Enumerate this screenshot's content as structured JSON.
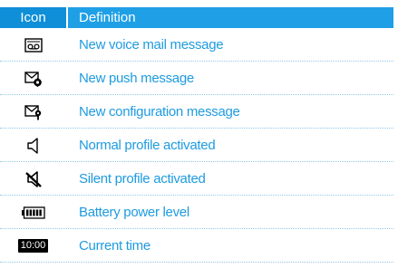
{
  "header": {
    "icon_col": "Icon",
    "definition_col": "Definition"
  },
  "rows": [
    {
      "icon": "voicemail-icon",
      "definition": "New voice mail message"
    },
    {
      "icon": "push-message-icon",
      "definition": "New push message"
    },
    {
      "icon": "configuration-message-icon",
      "definition": "New configuration message"
    },
    {
      "icon": "speaker-icon",
      "definition": "Normal profile activated"
    },
    {
      "icon": "speaker-muted-icon",
      "definition": "Silent profile activated"
    },
    {
      "icon": "battery-icon",
      "definition": "Battery power level"
    },
    {
      "icon": "clock-icon",
      "definition": "Current time",
      "icon_text": "10:00"
    }
  ],
  "colors": {
    "header_icon_bg": "#0f8fd8",
    "header_def_bg": "#1fa0e6",
    "text": "#1e9be0",
    "divider": "#8ec9ec"
  }
}
